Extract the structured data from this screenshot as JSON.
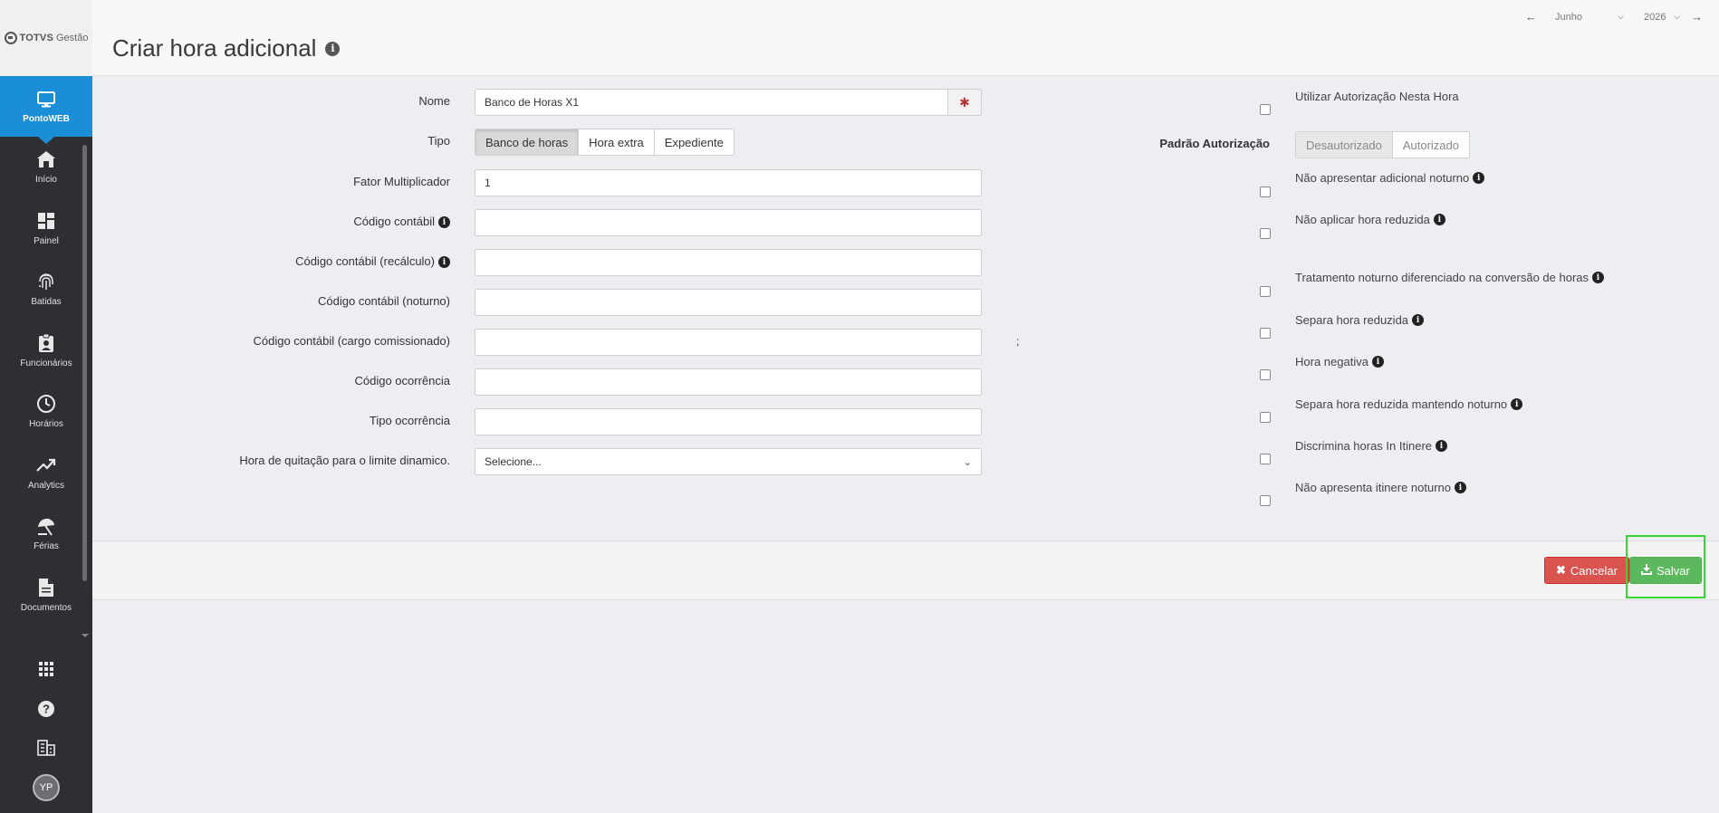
{
  "brand": {
    "name": "TOTVS",
    "product": "Gestão"
  },
  "sidebar": {
    "active": {
      "label": "PontoWEB",
      "icon": "monitor-icon"
    },
    "items": [
      {
        "label": "Início",
        "icon": "home-icon"
      },
      {
        "label": "Painel",
        "icon": "dashboard-icon"
      },
      {
        "label": "Batidas",
        "icon": "fingerprint-icon"
      },
      {
        "label": "Funcionários",
        "icon": "badge-icon"
      },
      {
        "label": "Horários",
        "icon": "clock-icon"
      },
      {
        "label": "Analytics",
        "icon": "trend-icon"
      },
      {
        "label": "Férias",
        "icon": "umbrella-icon"
      },
      {
        "label": "Documentos",
        "icon": "document-icon"
      }
    ],
    "avatar_initials": "YP"
  },
  "header": {
    "title": "Criar hora adicional",
    "period": {
      "month": "Junho",
      "year": "2026"
    }
  },
  "form": {
    "nome": {
      "label": "Nome",
      "value": "Banco de Horas X1"
    },
    "tipo": {
      "label": "Tipo",
      "options": [
        "Banco de horas",
        "Hora extra",
        "Expediente"
      ],
      "selected": "Banco de horas"
    },
    "fator": {
      "label": "Fator Multiplicador",
      "value": "1"
    },
    "codigo_contabil": {
      "label": "Código contábil",
      "value": ""
    },
    "codigo_recalculo": {
      "label": "Código contábil (recálculo)",
      "value": ""
    },
    "codigo_noturno": {
      "label": "Código contábil (noturno)",
      "value": ""
    },
    "codigo_cargo": {
      "label": "Código contábil (cargo comissionado)",
      "value": ""
    },
    "codigo_ocorrencia": {
      "label": "Código ocorrência",
      "value": ""
    },
    "tipo_ocorrencia": {
      "label": "Tipo ocorrência",
      "value": ""
    },
    "hora_quitacao": {
      "label": "Hora de quitação para o limite dinamico.",
      "selected": "Selecione..."
    },
    "separator": ";"
  },
  "options": {
    "utilizar_autorizacao": "Utilizar Autorização Nesta Hora",
    "padrao_autorizacao": {
      "label": "Padrão Autorização",
      "options": [
        "Desautorizado",
        "Autorizado"
      ]
    },
    "checkboxes": [
      "Não apresentar adicional noturno",
      "Não aplicar hora reduzida",
      "Tratamento noturno diferenciado na conversão de horas",
      "Separa hora reduzida",
      "Hora negativa",
      "Separa hora reduzida mantendo noturno",
      "Discrimina horas In Itinere",
      "Não apresenta itinere noturno"
    ]
  },
  "footer": {
    "cancel_label": "Cancelar",
    "save_label": "Salvar"
  },
  "colors": {
    "active_nav": "#1a8fd8",
    "cancel": "#d9534f",
    "save": "#5cb85c",
    "highlight": "#35d735"
  }
}
